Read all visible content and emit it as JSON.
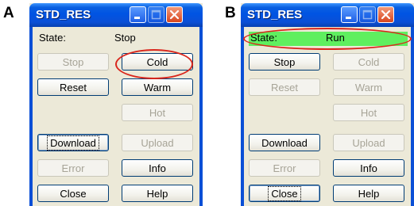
{
  "panel_a": {
    "letter": "A",
    "window": {
      "title": "STD_RES",
      "state_label": "State:",
      "state_value": "Stop",
      "buttons": {
        "stop": "Stop",
        "cold": "Cold",
        "reset": "Reset",
        "warm": "Warm",
        "hot": "Hot",
        "download": "Download",
        "upload": "Upload",
        "error": "Error",
        "info": "Info",
        "close": "Close",
        "help": "Help"
      }
    }
  },
  "panel_b": {
    "letter": "B",
    "window": {
      "title": "STD_RES",
      "state_label": "State:",
      "state_value": "Run",
      "buttons": {
        "stop": "Stop",
        "cold": "Cold",
        "reset": "Reset",
        "warm": "Warm",
        "hot": "Hot",
        "download": "Download",
        "upload": "Upload",
        "error": "Error",
        "info": "Info",
        "close": "Close",
        "help": "Help"
      }
    }
  },
  "colors": {
    "titlebar": "#0054e3",
    "window_background": "#ece9d8",
    "run_state_highlight": "#5fef5f",
    "annotation_ellipse": "#d9261c"
  }
}
